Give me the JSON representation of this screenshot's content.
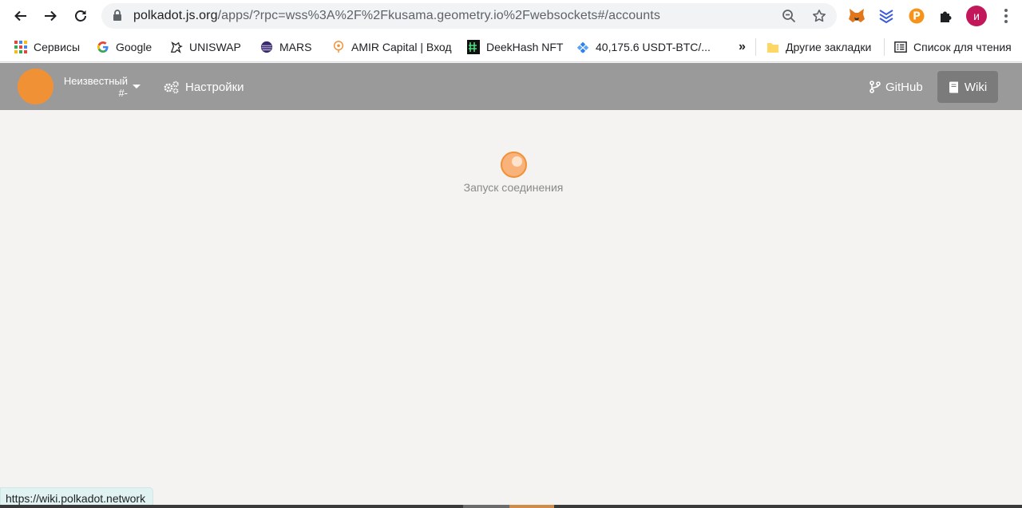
{
  "browser": {
    "url_host": "polkadot.js.org",
    "url_path": "/apps/?rpc=wss%3A%2F%2Fkusama.geometry.io%2Fwebsockets#/accounts",
    "profile_initial": "и",
    "status_url": "https://wiki.polkadot.network"
  },
  "bookmarks": {
    "items": [
      {
        "label": "Сервисы",
        "icon": "apps-grid-icon"
      },
      {
        "label": "Google",
        "icon": "google-icon"
      },
      {
        "label": "UNISWAP",
        "icon": "unicorn-icon"
      },
      {
        "label": "MARS",
        "icon": "planet-icon"
      },
      {
        "label": "AMIR Capital | Вход",
        "icon": "amir-icon"
      },
      {
        "label": "DeekHash NFT",
        "icon": "deekhash-icon"
      },
      {
        "label": "40,175.6 USDT-BTC/...",
        "icon": "exchange-icon"
      }
    ],
    "overflow": "»",
    "other_folder": "Другие закладки",
    "reading_list": "Список для чтения"
  },
  "app": {
    "chain_name": "Неизвестный",
    "chain_sub": "#-",
    "settings_label": "Настройки",
    "github_label": "GitHub",
    "wiki_label": "Wiki",
    "loading_text": "Запуск соединения"
  },
  "colors": {
    "header_bg": "#9a9a9a",
    "accent": "#f19135",
    "page_bg": "#f4f3f2"
  }
}
